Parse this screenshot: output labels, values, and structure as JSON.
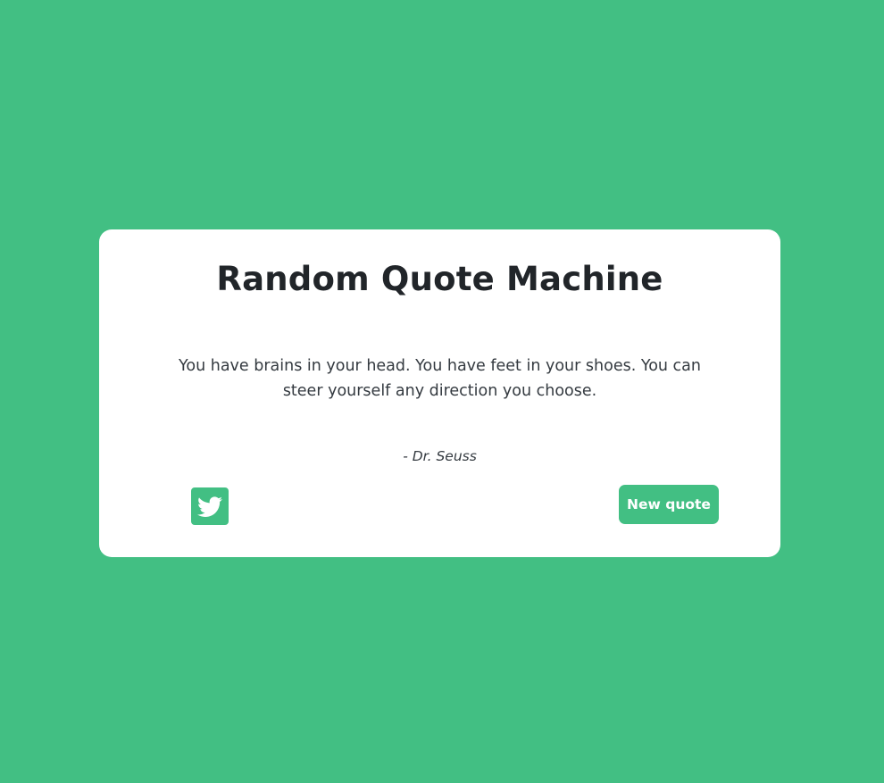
{
  "app": {
    "title": "Random Quote Machine"
  },
  "quote": {
    "text": "You have brains in your head. You have feet in your shoes. You can steer yourself any direction you choose.",
    "author": "- Dr. Seuss"
  },
  "actions": {
    "tweet_icon": "twitter-bird-icon",
    "new_quote_label": "New quote"
  },
  "colors": {
    "accent": "#42bf83",
    "card": "#ffffff",
    "text": "#212529"
  }
}
